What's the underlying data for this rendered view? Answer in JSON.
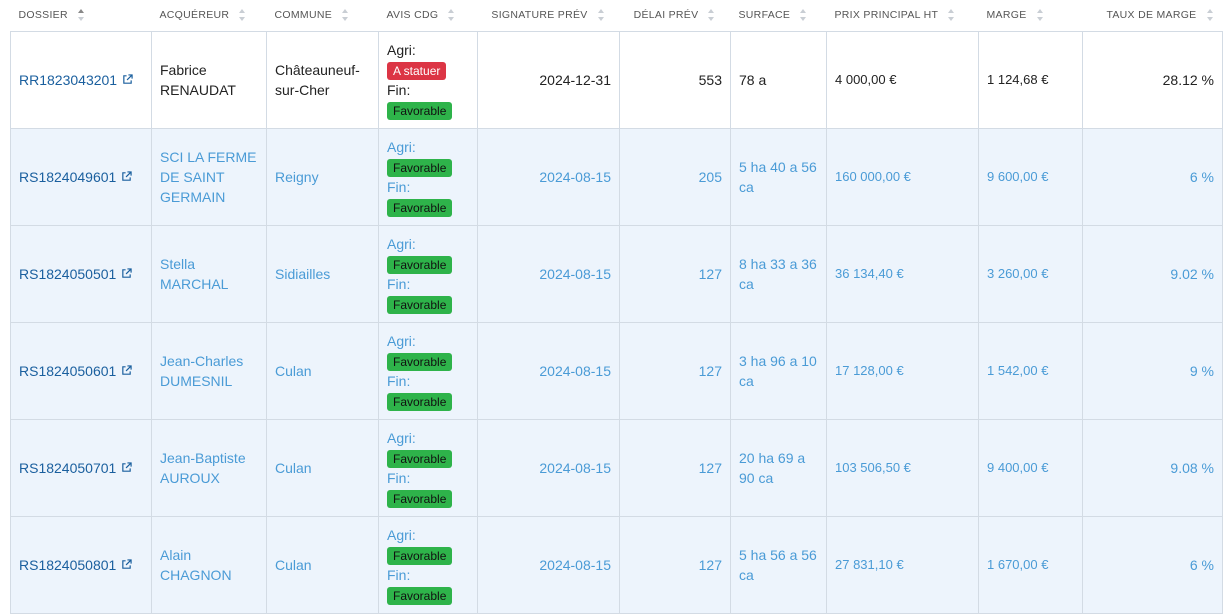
{
  "columns": [
    {
      "key": "dossier",
      "label": "Dossier",
      "align": "left",
      "active": true
    },
    {
      "key": "acquereur",
      "label": "Acquéreur",
      "align": "left"
    },
    {
      "key": "commune",
      "label": "Commune",
      "align": "left"
    },
    {
      "key": "avis",
      "label": "Avis CDG",
      "align": "left"
    },
    {
      "key": "signature",
      "label": "Signature prév",
      "align": "center"
    },
    {
      "key": "delai",
      "label": "Délai prév",
      "align": "center"
    },
    {
      "key": "surface",
      "label": "Surface",
      "align": "left"
    },
    {
      "key": "prix",
      "label": "Prix principal HT",
      "align": "left"
    },
    {
      "key": "marge",
      "label": "Marge",
      "align": "left"
    },
    {
      "key": "taux",
      "label": "Taux de marge",
      "align": "right"
    }
  ],
  "labels": {
    "agri": "Agri:",
    "fin": "Fin:"
  },
  "colors": {
    "favorable": "#2eb34a",
    "a_statuer": "#dc3545",
    "link": "#1a5f9e",
    "alt_row_bg": "#edf4fc",
    "alt_row_text": "#4a9bd6"
  },
  "rows": [
    {
      "dossier": "RR1823043201",
      "acquereur": "Fabrice RENAUDAT",
      "commune": "Châteauneuf-sur-Cher",
      "agri": "A statuer",
      "agri_status": "red",
      "fin": "Favorable",
      "fin_status": "green",
      "signature": "2024-12-31",
      "delai": "553",
      "surface": "78 a",
      "prix": "4 000,00 €",
      "marge": "1 124,68 €",
      "taux": "28.12 %"
    },
    {
      "dossier": "RS1824049601",
      "acquereur": "SCI LA FERME DE SAINT GERMAIN",
      "commune": "Reigny",
      "agri": "Favorable",
      "agri_status": "green",
      "fin": "Favorable",
      "fin_status": "green",
      "signature": "2024-08-15",
      "delai": "205",
      "surface": "5 ha 40 a 56 ca",
      "prix": "160 000,00 €",
      "marge": "9 600,00 €",
      "taux": "6 %"
    },
    {
      "dossier": "RS1824050501",
      "acquereur": "Stella MARCHAL",
      "commune": "Sidiailles",
      "agri": "Favorable",
      "agri_status": "green",
      "fin": "Favorable",
      "fin_status": "green",
      "signature": "2024-08-15",
      "delai": "127",
      "surface": "8 ha 33 a 36 ca",
      "prix": "36 134,40 €",
      "marge": "3 260,00 €",
      "taux": "9.02 %"
    },
    {
      "dossier": "RS1824050601",
      "acquereur": "Jean-Charles DUMESNIL",
      "commune": "Culan",
      "agri": "Favorable",
      "agri_status": "green",
      "fin": "Favorable",
      "fin_status": "green",
      "signature": "2024-08-15",
      "delai": "127",
      "surface": "3 ha 96 a 10 ca",
      "prix": "17 128,00 €",
      "marge": "1 542,00 €",
      "taux": "9 %"
    },
    {
      "dossier": "RS1824050701",
      "acquereur": "Jean-Baptiste AUROUX",
      "commune": "Culan",
      "agri": "Favorable",
      "agri_status": "green",
      "fin": "Favorable",
      "fin_status": "green",
      "signature": "2024-08-15",
      "delai": "127",
      "surface": "20 ha 69 a 90 ca",
      "prix": "103 506,50 €",
      "marge": "9 400,00 €",
      "taux": "9.08 %"
    },
    {
      "dossier": "RS1824050801",
      "acquereur": "Alain CHAGNON",
      "commune": "Culan",
      "agri": "Favorable",
      "agri_status": "green",
      "fin": "Favorable",
      "fin_status": "green",
      "signature": "2024-08-15",
      "delai": "127",
      "surface": "5 ha 56 a 56 ca",
      "prix": "27 831,10 €",
      "marge": "1 670,00 €",
      "taux": "6 %"
    }
  ]
}
